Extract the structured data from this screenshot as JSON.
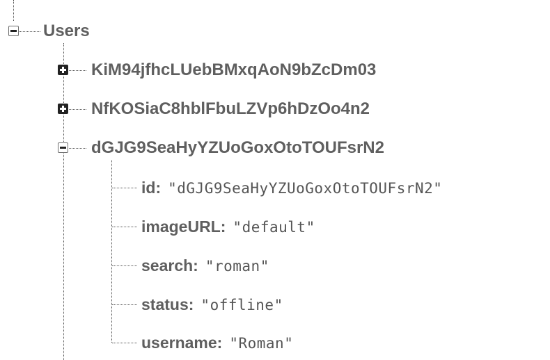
{
  "tree": {
    "root": {
      "label": "Users",
      "expanded": true
    },
    "children": [
      {
        "label": "KiM94jfhcLUebBMxqAoN9bZcDm03",
        "expanded": false
      },
      {
        "label": "NfKOSiaC8hblFbuLZVp6hDzOo4n2",
        "expanded": false
      },
      {
        "label": "dGJG9SeaHyYZUoGoxOtoTOUFsrN2",
        "expanded": true
      }
    ],
    "fields": [
      {
        "key": "id",
        "value": "\"dGJG9SeaHyYZUoGoxOtoTOUFsrN2\""
      },
      {
        "key": "imageURL",
        "value": "\"default\""
      },
      {
        "key": "search",
        "value": "\"roman\""
      },
      {
        "key": "status",
        "value": "\"offline\""
      },
      {
        "key": "username",
        "value": "\"Roman\""
      }
    ],
    "separator": ":",
    "icons": {
      "collapse": "collapse-toggle-icon",
      "expand": "expand-toggle-icon"
    }
  }
}
